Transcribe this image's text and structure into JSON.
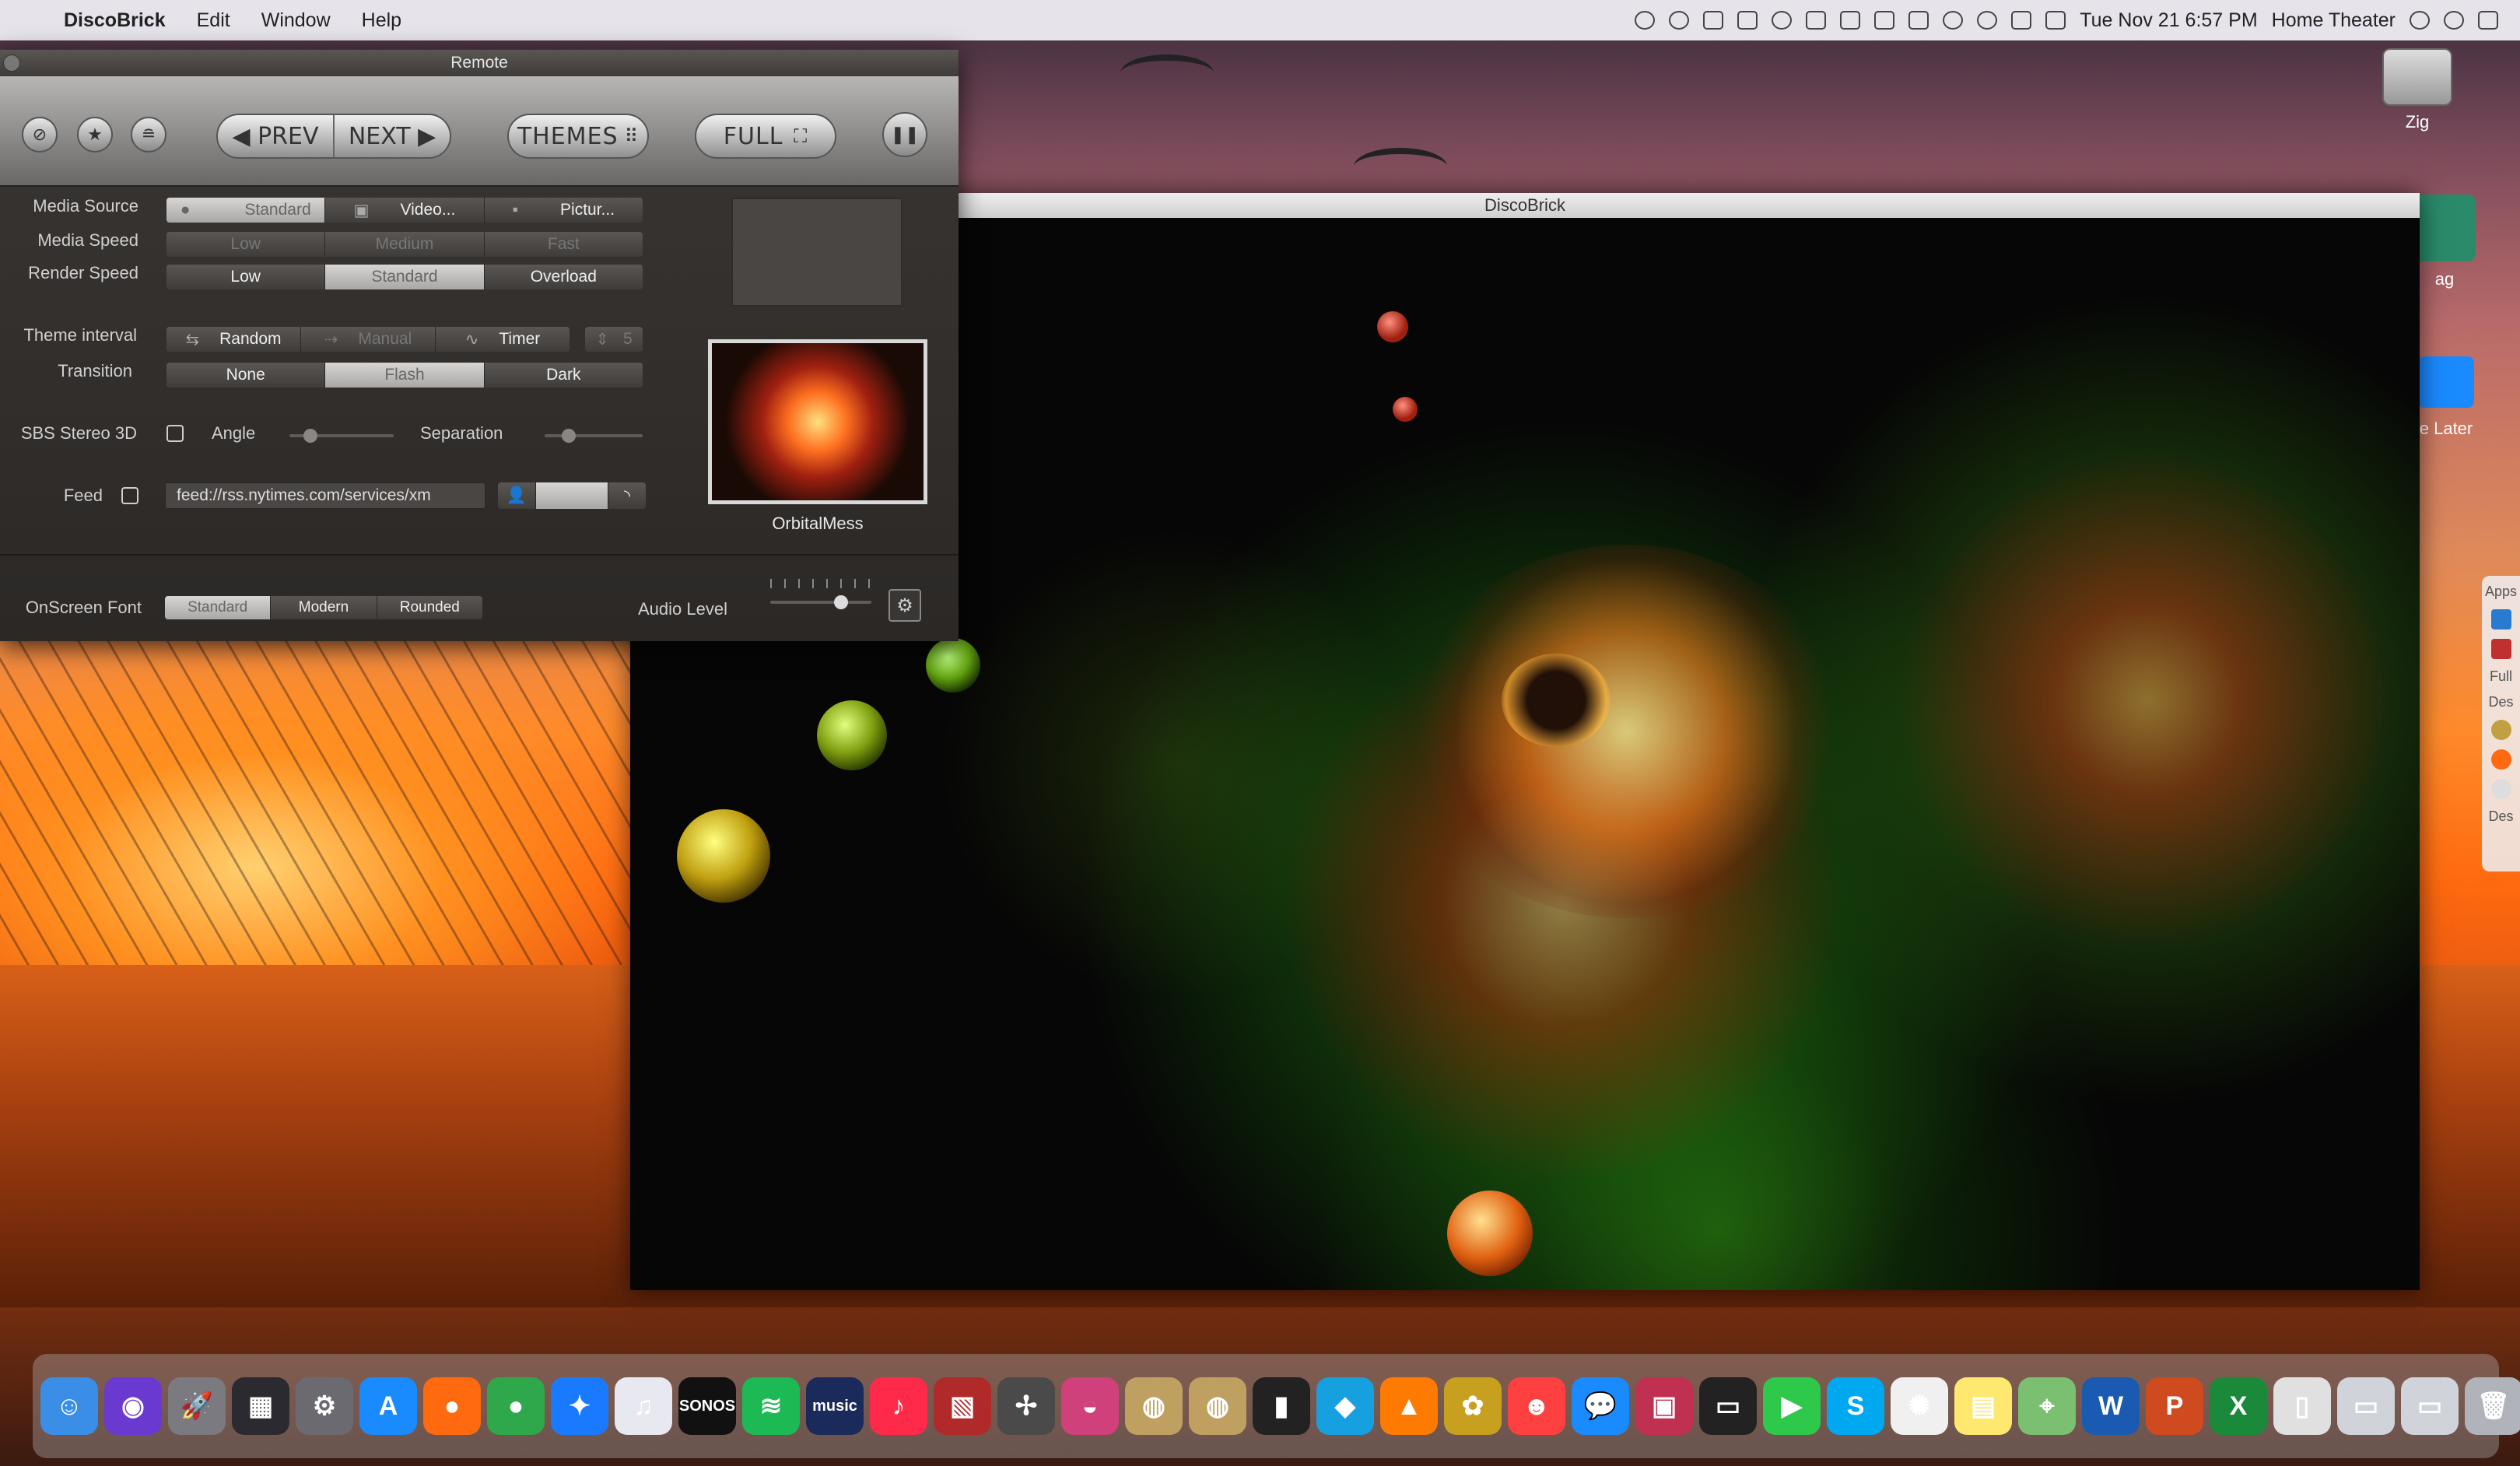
{
  "menubar": {
    "app_name": "DiscoBrick",
    "menus": [
      "Edit",
      "Window",
      "Help"
    ],
    "datetime": "Tue Nov 21  6:57 PM",
    "user": "Home Theater"
  },
  "desktop": {
    "hdd_label": "Zig",
    "partial_labels": [
      "ag",
      "e Later"
    ],
    "side_panel_items": [
      "Apps",
      "Full",
      "Des",
      "Des"
    ]
  },
  "viz_window": {
    "title": "DiscoBrick"
  },
  "remote": {
    "title": "Remote",
    "toolbar": {
      "prev_label": "PREV",
      "next_label": "NEXT",
      "themes_label": "THEMES",
      "full_label": "FULL"
    },
    "media_source": {
      "label": "Media Source",
      "options": [
        "Standard",
        "Video...",
        "Pictur..."
      ],
      "selected": "Standard"
    },
    "media_speed": {
      "label": "Media Speed",
      "options": [
        "Low",
        "Medium",
        "Fast"
      ]
    },
    "render_speed": {
      "label": "Render Speed",
      "options": [
        "Low",
        "Standard",
        "Overload"
      ],
      "selected": "Standard"
    },
    "theme_interval": {
      "label": "Theme interval",
      "options": [
        "Random",
        "Manual",
        "Timer"
      ],
      "timer_value": "5"
    },
    "transition": {
      "label": "Transition",
      "options": [
        "None",
        "Flash",
        "Dark"
      ],
      "selected": "Flash"
    },
    "stereo": {
      "label": "SBS Stereo 3D",
      "angle_label": "Angle",
      "separation_label": "Separation",
      "checked": false
    },
    "feed": {
      "label": "Feed",
      "url": "feed://rss.nytimes.com/services/xm",
      "checked": false
    },
    "theme_preview": {
      "name": "OrbitalMess"
    },
    "onscreen_font": {
      "label": "OnScreen Font",
      "options": [
        "Standard",
        "Modern",
        "Rounded"
      ],
      "selected": "Standard"
    },
    "audio_level": {
      "label": "Audio Level",
      "value": 0.7
    }
  },
  "dock": {
    "items": [
      {
        "name": "finder",
        "glyph": "☺",
        "color": "#3a8ee6"
      },
      {
        "name": "siri",
        "glyph": "◉",
        "color": "#6a3ad0"
      },
      {
        "name": "launchpad",
        "glyph": "🚀",
        "color": "#7a7a80"
      },
      {
        "name": "mission-control",
        "glyph": "▦",
        "color": "#2a2a30"
      },
      {
        "name": "system-preferences",
        "glyph": "⚙",
        "color": "#6a6a70"
      },
      {
        "name": "app-store",
        "glyph": "A",
        "color": "#1a8aff"
      },
      {
        "name": "firefox",
        "glyph": "●",
        "color": "#ff6a10"
      },
      {
        "name": "chrome",
        "glyph": "●",
        "color": "#2ea84a"
      },
      {
        "name": "safari",
        "glyph": "✦",
        "color": "#1a7aff"
      },
      {
        "name": "itunes",
        "glyph": "♫",
        "color": "#e8e8f0"
      },
      {
        "name": "sonos",
        "glyph": "SONOS",
        "color": "#111"
      },
      {
        "name": "spotify",
        "glyph": "≋",
        "color": "#1db954"
      },
      {
        "name": "amazon-music",
        "glyph": "music",
        "color": "#1a2a5a"
      },
      {
        "name": "music",
        "glyph": "♪",
        "color": "#ff2a4a"
      },
      {
        "name": "photo-app",
        "glyph": "▧",
        "color": "#b02a2a"
      },
      {
        "name": "windmill-app",
        "glyph": "✢",
        "color": "#4a4a4a"
      },
      {
        "name": "bowl-app",
        "glyph": "◒",
        "color": "#d0407a"
      },
      {
        "name": "discoball-1",
        "glyph": "◍",
        "color": "#c0a060"
      },
      {
        "name": "discoball-2",
        "glyph": "◍",
        "color": "#c0a060"
      },
      {
        "name": "remote-app",
        "glyph": "▮",
        "color": "#222"
      },
      {
        "name": "kodi",
        "glyph": "◆",
        "color": "#17a0e0"
      },
      {
        "name": "vlc",
        "glyph": "▲",
        "color": "#ff7a00"
      },
      {
        "name": "pineapple-app",
        "glyph": "✿",
        "color": "#c8a020"
      },
      {
        "name": "robot-app",
        "glyph": "☻",
        "color": "#ff4040"
      },
      {
        "name": "messenger",
        "glyph": "💬",
        "color": "#1a8aff"
      },
      {
        "name": "photo-booth",
        "glyph": "▣",
        "color": "#c03050"
      },
      {
        "name": "display-app",
        "glyph": "▭",
        "color": "#222"
      },
      {
        "name": "facetime",
        "glyph": "▶",
        "color": "#2ec84a"
      },
      {
        "name": "skype",
        "glyph": "S",
        "color": "#00a8f0"
      },
      {
        "name": "photos",
        "glyph": "✺",
        "color": "#f0f0f0"
      },
      {
        "name": "notes",
        "glyph": "▤",
        "color": "#ffe870"
      },
      {
        "name": "maps",
        "glyph": "⌖",
        "color": "#7ac070"
      },
      {
        "name": "word",
        "glyph": "W",
        "color": "#1a5ab0"
      },
      {
        "name": "powerpoint",
        "glyph": "P",
        "color": "#d04a20"
      },
      {
        "name": "excel",
        "glyph": "X",
        "color": "#1a8a3a"
      },
      {
        "name": "documents",
        "glyph": "▯",
        "color": "#e0e0e0"
      },
      {
        "name": "folder-1",
        "glyph": "▭",
        "color": "#d0d4da"
      },
      {
        "name": "folder-2",
        "glyph": "▭",
        "color": "#d0d4da"
      },
      {
        "name": "trash",
        "glyph": "🗑",
        "color": "#b0b4ba"
      }
    ]
  }
}
